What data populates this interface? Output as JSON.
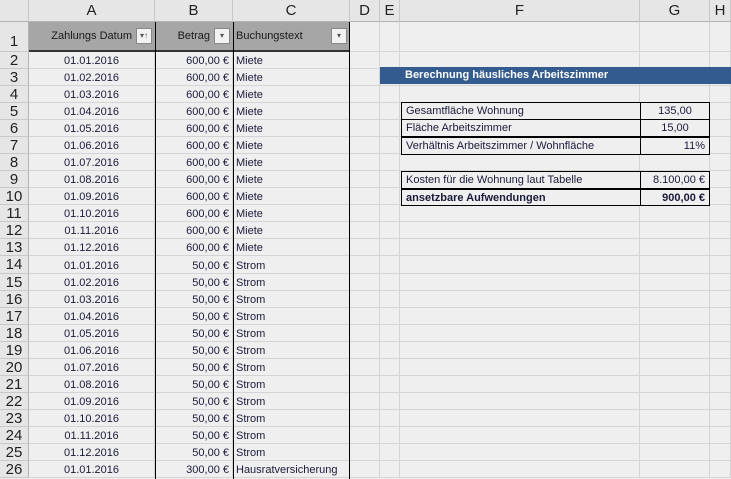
{
  "columns": [
    "A",
    "B",
    "C",
    "D",
    "E",
    "F",
    "G",
    "H"
  ],
  "table": {
    "headers": [
      "Zahlungs Datum",
      "Betrag",
      "Buchungstext"
    ],
    "filter_icons": [
      "sort-ascending-filter-icon",
      "dropdown-filter-icon",
      "dropdown-filter-icon"
    ],
    "rows": [
      [
        "01.01.2016",
        "600,00 €",
        "Miete"
      ],
      [
        "01.02.2016",
        "600,00 €",
        "Miete"
      ],
      [
        "01.03.2016",
        "600,00 €",
        "Miete"
      ],
      [
        "01.04.2016",
        "600,00 €",
        "Miete"
      ],
      [
        "01.05.2016",
        "600,00 €",
        "Miete"
      ],
      [
        "01.06.2016",
        "600,00 €",
        "Miete"
      ],
      [
        "01.07.2016",
        "600,00 €",
        "Miete"
      ],
      [
        "01.08.2016",
        "600,00 €",
        "Miete"
      ],
      [
        "01.09.2016",
        "600,00 €",
        "Miete"
      ],
      [
        "01.10.2016",
        "600,00 €",
        "Miete"
      ],
      [
        "01.11.2016",
        "600,00 €",
        "Miete"
      ],
      [
        "01.12.2016",
        "600,00 €",
        "Miete"
      ],
      [
        "01.01.2016",
        "50,00 €",
        "Strom"
      ],
      [
        "01.02.2016",
        "50,00 €",
        "Strom"
      ],
      [
        "01.03.2016",
        "50,00 €",
        "Strom"
      ],
      [
        "01.04.2016",
        "50,00 €",
        "Strom"
      ],
      [
        "01.05.2016",
        "50,00 €",
        "Strom"
      ],
      [
        "01.06.2016",
        "50,00 €",
        "Strom"
      ],
      [
        "01.07.2016",
        "50,00 €",
        "Strom"
      ],
      [
        "01.08.2016",
        "50,00 €",
        "Strom"
      ],
      [
        "01.09.2016",
        "50,00 €",
        "Strom"
      ],
      [
        "01.10.2016",
        "50,00 €",
        "Strom"
      ],
      [
        "01.11.2016",
        "50,00 €",
        "Strom"
      ],
      [
        "01.12.2016",
        "50,00 €",
        "Strom"
      ],
      [
        "01.01.2016",
        "300,00 €",
        "Hausratversicherung"
      ]
    ]
  },
  "calc": {
    "title": "Berechnung häusliches Arbeitszimmer",
    "title_bg": "#335b8e",
    "gesamt_label": "Gesamtfläche Wohnung",
    "gesamt_value": "135,00",
    "flaeche_label": "Fläche Arbeitszimmer",
    "flaeche_value": "15,00",
    "verh_label": "Verhältnis Arbeitszimmer / Wohnfläche",
    "verh_value": "11%",
    "kosten_label": "Kosten für die Wohnung laut Tabelle",
    "kosten_value": "8.100,00 €",
    "aufw_label": "ansetzbare Aufwendungen",
    "aufw_value": "900,00 €"
  }
}
